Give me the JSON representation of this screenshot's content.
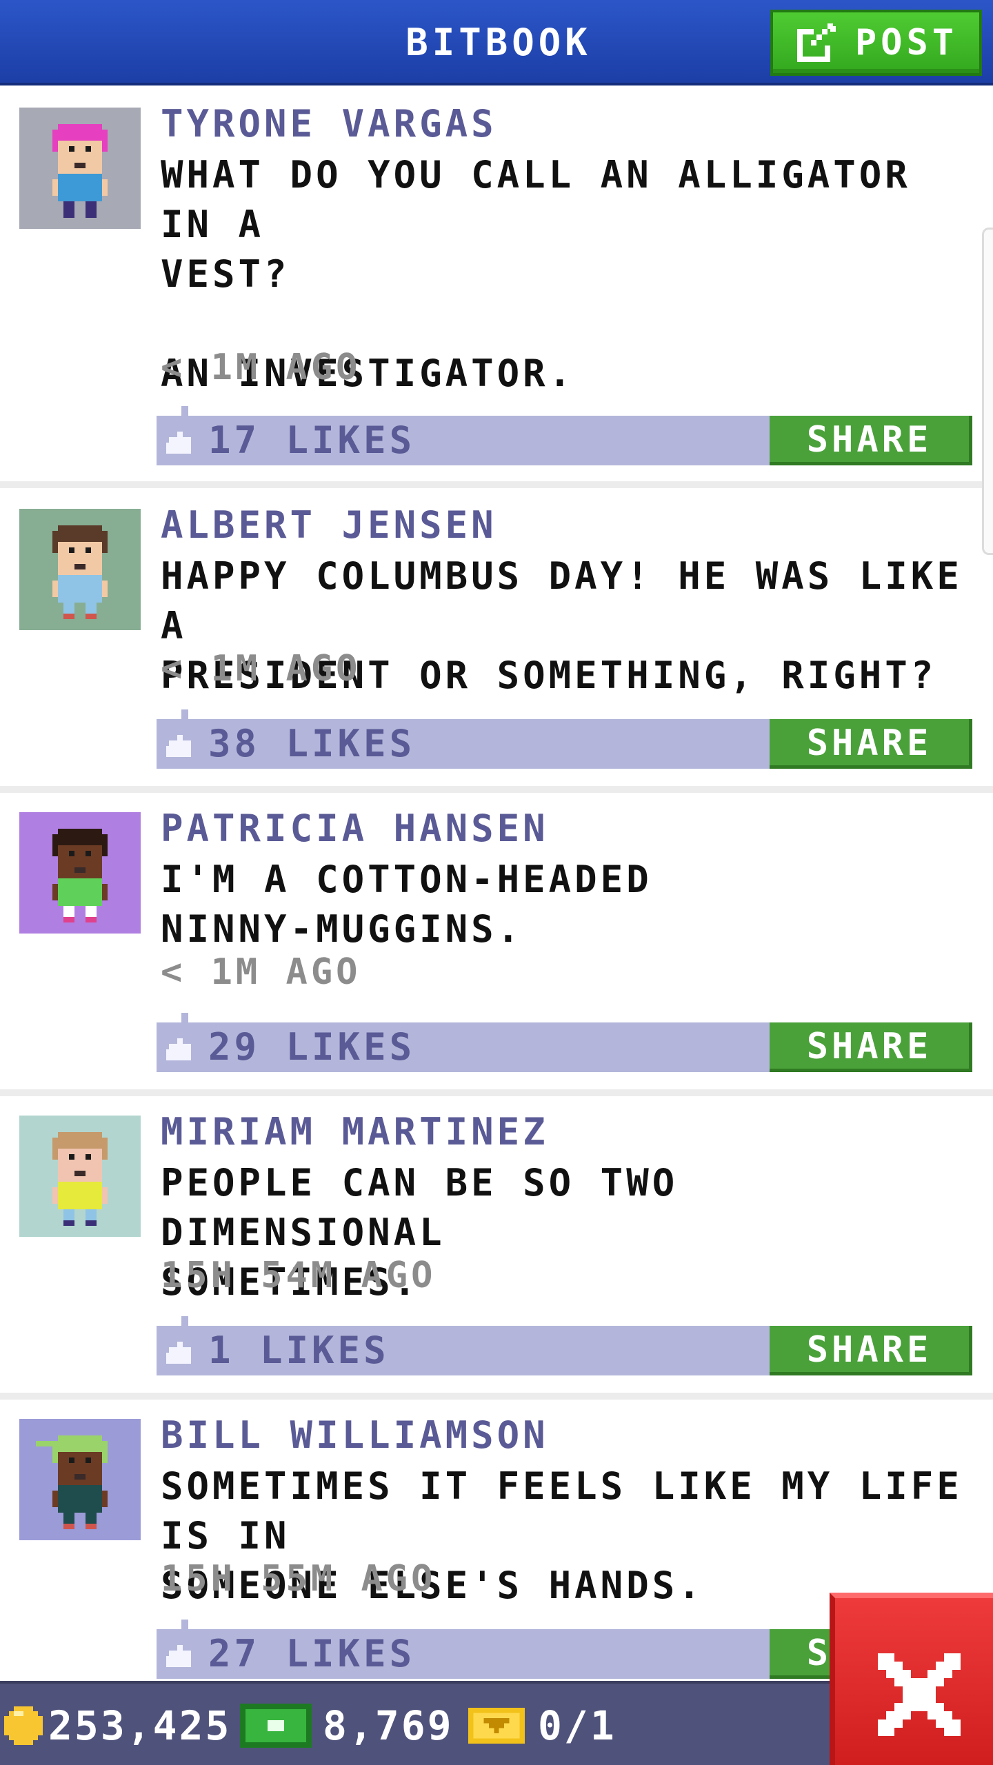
{
  "header": {
    "title": "BITBOOK",
    "post_label": "POST",
    "post_icon": "compose-icon"
  },
  "posts": [
    {
      "author": "TYRONE VARGAS",
      "text": "WHAT DO YOU CALL AN ALLIGATOR IN A\nVEST?\n\nAN INVESTIGATOR.",
      "time": "< 1M AGO",
      "likes": "17 LIKES",
      "share": "SHARE",
      "avatar": {
        "bg": "#a7a9b4",
        "hair": "#e63fc0",
        "skin": "#f2c9a5",
        "shirt": "#3d9ad6",
        "pants": "#3b2f78",
        "shoes": "#3b2f78"
      }
    },
    {
      "author": "ALBERT JENSEN",
      "text": "HAPPY COLUMBUS DAY! HE WAS LIKE A\nPRESIDENT OR SOMETHING, RIGHT?",
      "time": "< 1M AGO",
      "likes": "38 LIKES",
      "share": "SHARE",
      "avatar": {
        "bg": "#87ad93",
        "hair": "#5a3a28",
        "skin": "#f2c9a5",
        "shirt": "#8fc4e6",
        "pants": "#8fc4e6",
        "shoes": "#d0554d"
      }
    },
    {
      "author": "PATRICIA HANSEN",
      "text": "I'M A COTTON-HEADED\nNINNY-MUGGINS.",
      "time": "< 1M AGO",
      "likes": "29 LIKES",
      "share": "SHARE",
      "avatar": {
        "bg": "#b07fe2",
        "hair": "#2c1a12",
        "skin": "#6b3b24",
        "shirt": "#5fd15a",
        "pants": "#ffffff",
        "shoes": "#e0418c"
      }
    },
    {
      "author": "MIRIAM MARTINEZ",
      "text": "PEOPLE CAN BE SO TWO DIMENSIONAL\nSOMETIMES.",
      "time": "15H 54M AGO",
      "likes": "1 LIKES",
      "share": "SHARE",
      "avatar": {
        "bg": "#b2d6cf",
        "hair": "#c69a6b",
        "skin": "#f0c4b0",
        "shirt": "#e6ea3a",
        "pants": "#8fc4e6",
        "shoes": "#3b2f78"
      }
    },
    {
      "author": "BILL WILLIAMSON",
      "text": "SOMETIMES IT FEELS LIKE MY LIFE IS IN\nSOMEONE ELSE'S HANDS.",
      "time": "15H 55M AGO",
      "likes": "27 LIKES",
      "share": "SHARE",
      "avatar": {
        "bg": "#9b9bd8",
        "hair": "#9ad36a",
        "skin": "#6b3b24",
        "shirt": "#1f4c4c",
        "pants": "#1f4c4c",
        "shoes": "#d0554d",
        "hat": true
      }
    }
  ],
  "bottom_bar": {
    "coins": "253,425",
    "coin_icon": "coin-icon",
    "bux": "8,769",
    "bux_icon": "bux-icon",
    "tickets": "0/1",
    "ticket_icon": "ticket-icon"
  },
  "close_icon": "close-icon"
}
